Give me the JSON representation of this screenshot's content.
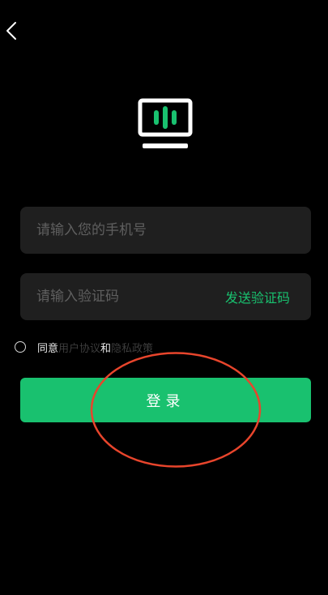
{
  "header": {
    "back_icon": "chevron-left-icon"
  },
  "logo": {
    "icon": "monitor-soundwave-logo",
    "accent_color": "#19c16f"
  },
  "form": {
    "phone_placeholder": "请输入您的手机号",
    "phone_value": "",
    "code_placeholder": "请输入验证码",
    "code_value": "",
    "send_code_label": "发送验证码"
  },
  "agreement": {
    "prefix": "同意",
    "user_agreement": "用户协议",
    "conjunction": "和",
    "privacy_policy": "隐私政策",
    "checked": false
  },
  "login": {
    "label": "登录"
  },
  "colors": {
    "background": "#000000",
    "field_background": "#1f1f1f",
    "accent": "#19c16f",
    "annotation": "#e8452c"
  }
}
